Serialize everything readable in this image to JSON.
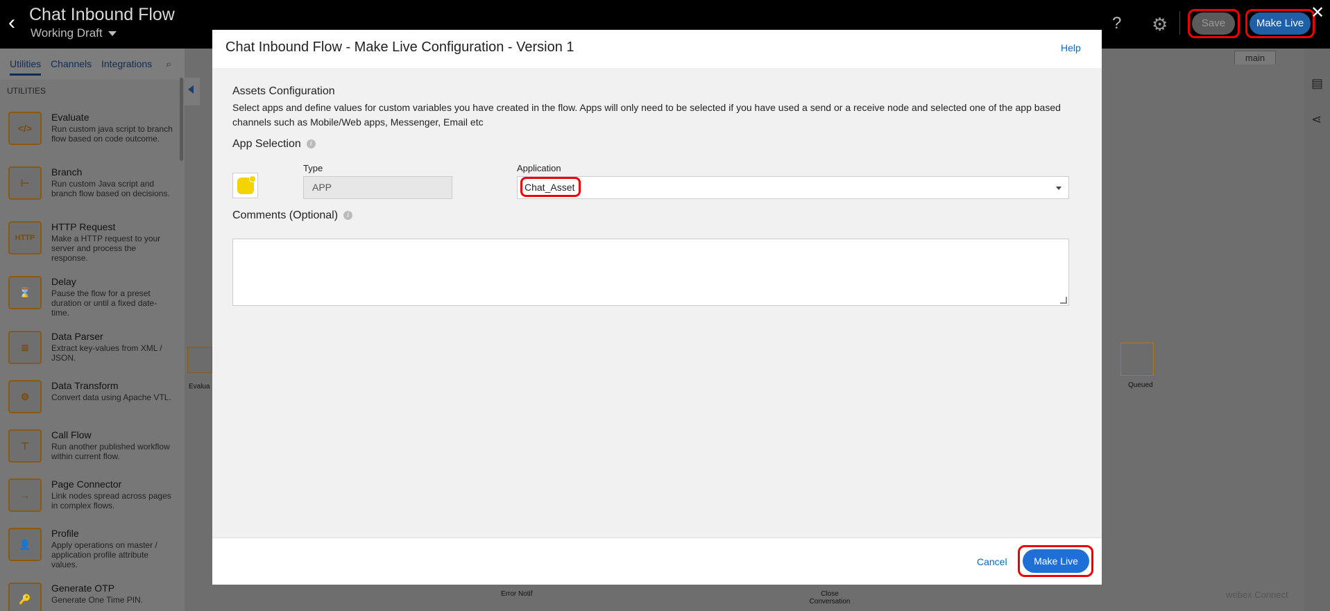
{
  "header": {
    "title": "Chat Inbound Flow",
    "draft_label": "Working Draft",
    "help_glyph": "?",
    "save_label": "Save",
    "make_live_label": "Make Live",
    "close_glyph": "✕",
    "back_glyph": "‹"
  },
  "sidebar": {
    "tabs": [
      {
        "label": "Utilities"
      },
      {
        "label": "Channels"
      },
      {
        "label": "Integrations"
      }
    ],
    "section_heading": "UTILITIES",
    "items": [
      {
        "name": "Evaluate",
        "desc": "Run custom java script to branch flow based on code outcome.",
        "icon": "code-icon",
        "glyph": "</>"
      },
      {
        "name": "Branch",
        "desc": "Run custom Java script and branch flow based on decisions.",
        "icon": "branch-icon",
        "glyph": "⊢"
      },
      {
        "name": "HTTP Request",
        "desc": "Make a HTTP request to your server and process the response.",
        "icon": "http-icon",
        "glyph": "HTTP"
      },
      {
        "name": "Delay",
        "desc": "Pause the flow for a preset duration or until a fixed date-time.",
        "icon": "hourglass-icon",
        "glyph": "⌛"
      },
      {
        "name": "Data Parser",
        "desc": "Extract key-values from XML / JSON.",
        "icon": "data-parser-icon",
        "glyph": "≣"
      },
      {
        "name": "Data Transform",
        "desc": "Convert data using Apache VTL.",
        "icon": "data-transform-icon",
        "glyph": "⚙"
      },
      {
        "name": "Call Flow",
        "desc": "Run another published workflow within current flow.",
        "icon": "call-flow-icon",
        "glyph": "⊤"
      },
      {
        "name": "Page Connector",
        "desc": "Link nodes spread across pages in complex flows.",
        "icon": "page-connector-icon",
        "glyph": "→"
      },
      {
        "name": "Profile",
        "desc": "Apply operations on master / application profile attribute values.",
        "icon": "profile-icon",
        "glyph": "👤"
      },
      {
        "name": "Generate OTP",
        "desc": "Generate One Time PIN.",
        "icon": "key-icon",
        "glyph": "🔑"
      }
    ]
  },
  "canvas": {
    "tab_label": "main",
    "node_labels": [
      "Evalua",
      "Queued",
      "Error Notif",
      "Close Conversation"
    ],
    "brand": "webex Connect"
  },
  "modal": {
    "title": "Chat Inbound Flow - Make Live Configuration - Version 1",
    "help_label": "Help",
    "assets_title": "Assets Configuration",
    "assets_desc": "Select apps and define values for custom variables you have created in the flow. Apps will only need to be selected if you have used a send or a receive node and selected one of the app based channels such as Mobile/Web apps, Messenger, Email etc",
    "app_selection_label": "App Selection",
    "type_label": "Type",
    "type_value": "APP",
    "application_label": "Application",
    "application_value": "Chat_Asset",
    "comments_label": "Comments (Optional)",
    "comments_value": "",
    "cancel_label": "Cancel",
    "make_live_label": "Make Live"
  },
  "colors": {
    "accent": "#1f70d6",
    "highlight_ring": "#e00000",
    "app_icon": "#f3d400"
  }
}
